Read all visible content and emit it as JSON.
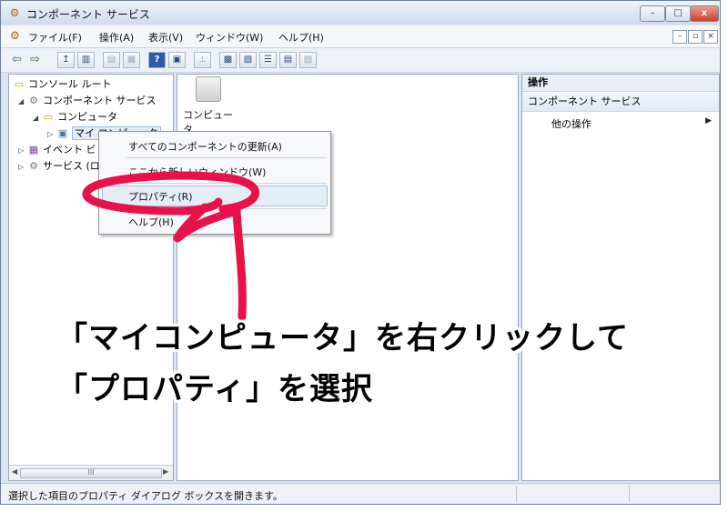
{
  "window": {
    "title": "コンポーネント サービス",
    "minimize_label": "–",
    "maximize_label": "□",
    "close_label": "x"
  },
  "menubar": {
    "items": [
      "ファイル(F)",
      "操作(A)",
      "表示(V)",
      "ウィンドウ(W)",
      "ヘルプ(H)"
    ]
  },
  "tree": {
    "items": [
      {
        "label": "コンソール ルート",
        "icon": "folder-icon"
      },
      {
        "label": "コンポーネント サービス",
        "icon": "gear-icon"
      },
      {
        "label": "コンピュータ",
        "icon": "folder-icon"
      },
      {
        "label": "マイ コンピュータ",
        "icon": "computer-icon"
      },
      {
        "label": "イベント ビ",
        "icon": "event-viewer-icon"
      },
      {
        "label": "サービス (ロ",
        "icon": "services-icon"
      }
    ],
    "scroll_grip": "III"
  },
  "content": {
    "item_label": "コンピュータ"
  },
  "actions": {
    "header": "操作",
    "section": "コンポーネント サービス",
    "item": "他の操作"
  },
  "context_menu": {
    "items": [
      "すべてのコンポーネントの更新(A)",
      "ここから新しいウィンドウ(W)",
      "プロパティ(R)",
      "ヘルプ(H)"
    ]
  },
  "status": {
    "text": "選択した項目のプロパティ ダイアログ ボックスを開きます。"
  },
  "annotation": {
    "line1": "「マイコンピュータ」を右クリックして",
    "line2": "「プロパティ」を選択",
    "stroke_color": "#e8124a"
  }
}
